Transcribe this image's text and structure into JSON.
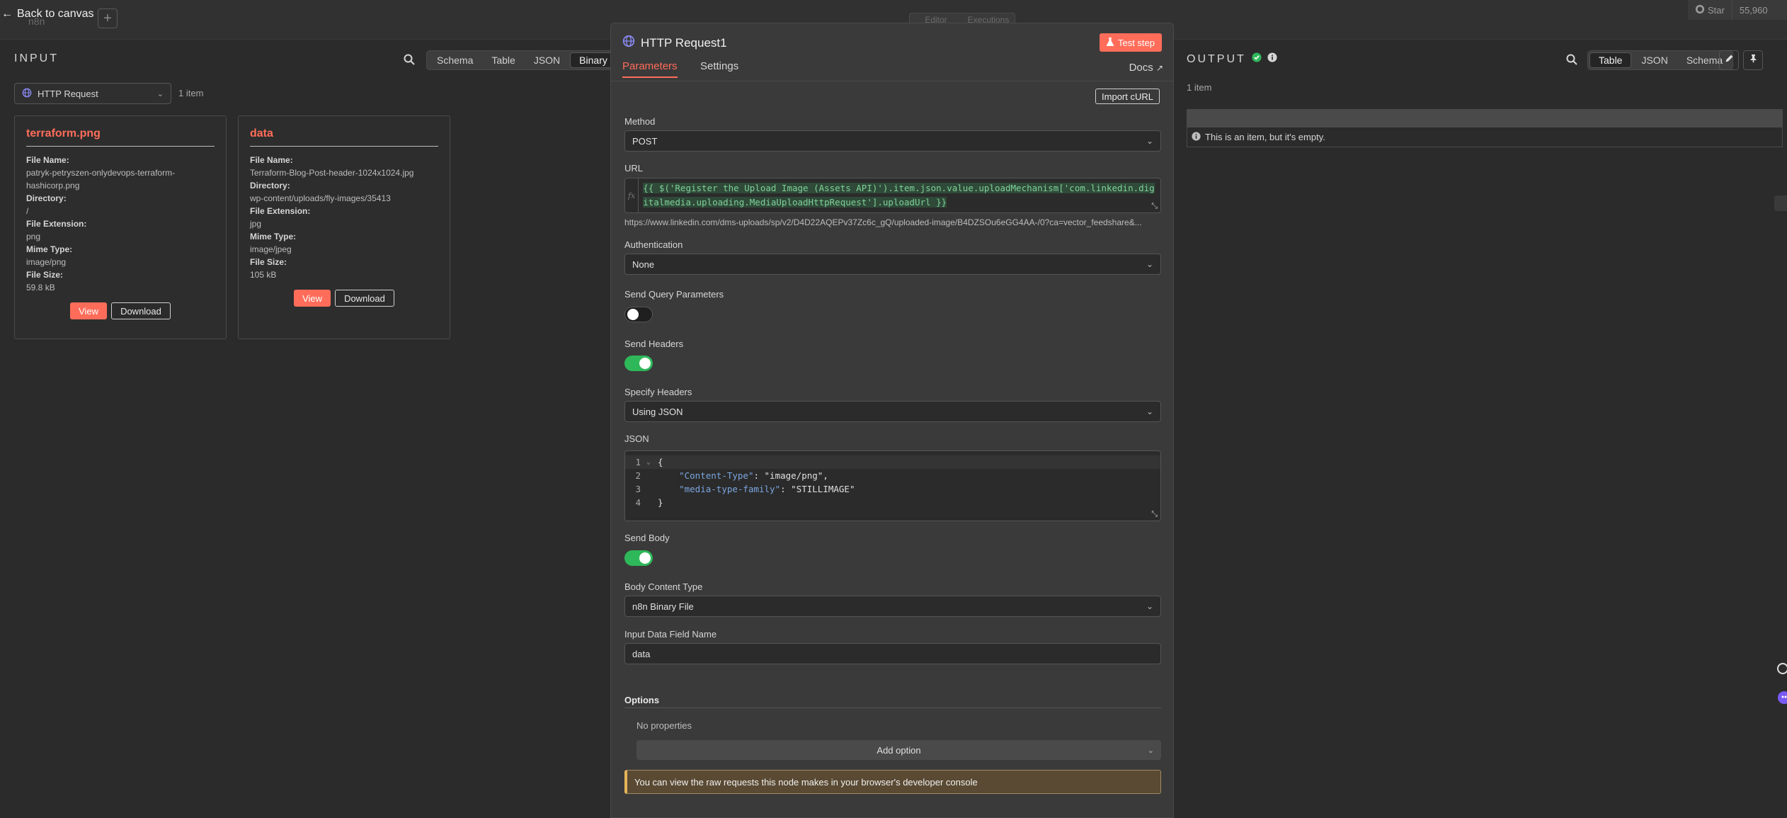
{
  "header": {
    "back_label": "Back to canvas",
    "app_ghost": "n8n",
    "ghost_tabs": [
      "Editor",
      "Executions"
    ],
    "github_star_label": "Star",
    "github_star_count": "55,960"
  },
  "input_panel": {
    "title": "INPUT",
    "view_tabs": [
      "Schema",
      "Table",
      "JSON",
      "Binary"
    ],
    "active_view": "Binary",
    "node_select": "HTTP Request",
    "item_count": "1 item",
    "cards": [
      {
        "title": "terraform.png",
        "fields": [
          {
            "label": "File Name:",
            "value": "patryk-petryszen-onlydevops-terraform-hashicorp.png"
          },
          {
            "label": "Directory:",
            "value": "/"
          },
          {
            "label": "File Extension:",
            "value": "png"
          },
          {
            "label": "Mime Type:",
            "value": "image/png"
          },
          {
            "label": "File Size:",
            "value": "59.8 kB"
          }
        ]
      },
      {
        "title": "data",
        "fields": [
          {
            "label": "File Name:",
            "value": "Terraform-Blog-Post-header-1024x1024.jpg"
          },
          {
            "label": "Directory:",
            "value": "wp-content/uploads/fly-images/35413"
          },
          {
            "label": "File Extension:",
            "value": "jpg"
          },
          {
            "label": "Mime Type:",
            "value": "image/jpeg"
          },
          {
            "label": "File Size:",
            "value": "105 kB"
          }
        ]
      }
    ],
    "view_label": "View",
    "download_label": "Download"
  },
  "modal": {
    "title": "HTTP Request1",
    "test_step_label": "Test step",
    "tabs": [
      "Parameters",
      "Settings"
    ],
    "active_tab": "Parameters",
    "docs_label": "Docs",
    "import_curl_label": "Import cURL",
    "method_label": "Method",
    "method_value": "POST",
    "url_label": "URL",
    "url_expression": "{{ $('Register the Upload Image (Assets API)').item.json.value.uploadMechanism['com.linkedin.digitalmedia.uploading.MediaUploadHttpRequest'].uploadUrl }}",
    "url_preview": "https://www.linkedin.com/dms-uploads/sp/v2/D4D22AQEPv37Zc6c_gQ/uploaded-image/B4DZSOu6eGG4AA-/0?ca=vector_feedshare&...",
    "auth_label": "Authentication",
    "auth_value": "None",
    "send_query_label": "Send Query Parameters",
    "send_query_on": false,
    "send_headers_label": "Send Headers",
    "send_headers_on": true,
    "specify_headers_label": "Specify Headers",
    "specify_headers_value": "Using JSON",
    "json_label": "JSON",
    "json_lines": [
      {
        "n": "1",
        "text": "{"
      },
      {
        "n": "2",
        "key": "\"Content-Type\"",
        "val": "\"image/png\","
      },
      {
        "n": "3",
        "key": "\"media-type-family\"",
        "val": "\"STILLIMAGE\""
      },
      {
        "n": "4",
        "text": "}"
      }
    ],
    "send_body_label": "Send Body",
    "send_body_on": true,
    "body_content_type_label": "Body Content Type",
    "body_content_type_value": "n8n Binary File",
    "input_field_label": "Input Data Field Name",
    "input_field_value": "data",
    "options_label": "Options",
    "no_properties_label": "No properties",
    "add_option_label": "Add option",
    "notice_text": "You can view the raw requests this node makes in your browser's developer console"
  },
  "output_panel": {
    "title": "OUTPUT",
    "view_tabs": [
      "Table",
      "JSON",
      "Schema"
    ],
    "active_view": "Table",
    "item_count": "1 item",
    "empty_message": "This is an item, but it's empty."
  },
  "colors": {
    "accent": "#ff6d5a",
    "success": "#2fb85a",
    "background": "#2b2b2b",
    "modal": "#3a3a3a"
  }
}
